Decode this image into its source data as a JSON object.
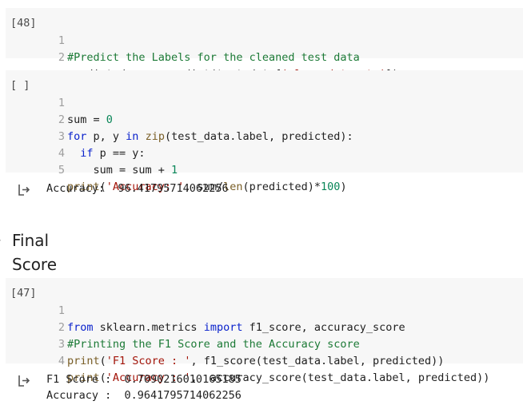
{
  "cells": [
    {
      "exec_label": "[48]",
      "lines": [
        {
          "num": "1",
          "code": "#Predict the Labels for the cleaned test data"
        },
        {
          "num": "2",
          "code": "predicted = gs.predict(test_data['cleaned_tweets'])"
        }
      ]
    },
    {
      "exec_label": "[ ]",
      "lines": [
        {
          "num": "1",
          "code": "sum = 0"
        },
        {
          "num": "2",
          "code": "for p, y in zip(test_data.label, predicted):"
        },
        {
          "num": "3",
          "code": "  if p == y:"
        },
        {
          "num": "4",
          "code": "    sum = sum + 1"
        },
        {
          "num": "5",
          "code": "print('Accuracy: ', sum/len(predicted)*100)"
        }
      ],
      "output": [
        "Accuracy:  96.41795714062256"
      ]
    },
    {
      "exec_label": "[47]",
      "lines": [
        {
          "num": "1",
          "code": "from sklearn.metrics import f1_score, accuracy_score"
        },
        {
          "num": "2",
          "code": "#Printing the F1 Score and the Accuracy score"
        },
        {
          "num": "3",
          "code": "print('F1 Score : ', f1_score(test_data.label, predicted))"
        },
        {
          "num": "4",
          "code": "print('Accuracy : ',  accuracy_score(test_data.label, predicted))"
        }
      ],
      "output": [
        "F1 Score :  0.7090216010165185",
        "Accuracy :  0.9641795714062256"
      ]
    }
  ],
  "section": {
    "title": "Final Score",
    "chevron": "chevron-left-icon"
  },
  "output_icon": "output-arrow-icon"
}
